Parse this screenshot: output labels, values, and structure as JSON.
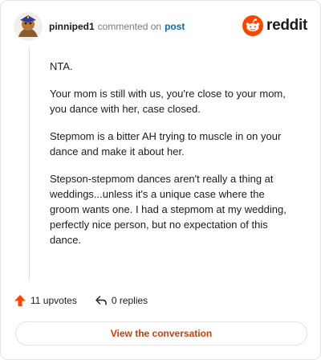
{
  "header": {
    "username": "pinniped1",
    "commented_text": "commented on",
    "post_link": "post",
    "logo_text": "reddit"
  },
  "comment": {
    "paragraphs": [
      "NTA.",
      "Your mom is still with us, you're close to your mom, you dance with her, case closed.",
      "Stepmom is a bitter AH trying to muscle in on your dance and make it about her.",
      "Stepson-stepmom dances aren't really a thing at weddings...unless it's a unique case where the groom wants one. I had a stepmom at my wedding, perfectly nice person, but no expectation of this dance."
    ]
  },
  "actions": {
    "upvotes": "11 upvotes",
    "replies": "0 replies"
  },
  "footer": {
    "view_button": "View the conversation"
  },
  "colors": {
    "accent": "#ff4500",
    "link": "#0a66c2",
    "button_text": "#d93a00"
  },
  "icons": {
    "upvote": "upvote-arrow-icon",
    "reply": "reply-arrow-icon",
    "logo": "reddit-snoo-icon"
  }
}
